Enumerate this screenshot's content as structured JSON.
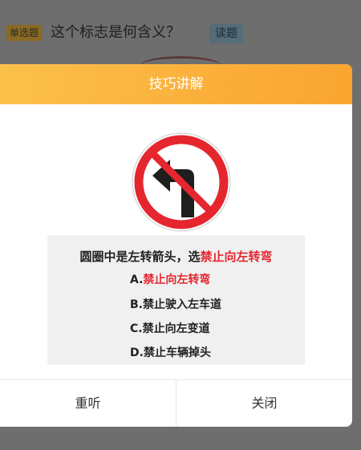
{
  "question": {
    "type_badge": "单选题",
    "text": "这个标志是何含义？",
    "read_button": "读题"
  },
  "modal": {
    "title": "技巧讲解",
    "hint_prefix": "圆圈中是左转箭头，选",
    "hint_answer": "禁止向左转弯",
    "options": [
      {
        "letter": "A.",
        "text": "禁止向左转弯",
        "correct": true
      },
      {
        "letter": "B.",
        "text": "禁止驶入左车道",
        "correct": false
      },
      {
        "letter": "C.",
        "text": "禁止向左变道",
        "correct": false
      },
      {
        "letter": "D.",
        "text": "禁止车辆掉头",
        "correct": false
      }
    ],
    "footer": {
      "replay": "重听",
      "close": "关闭"
    }
  },
  "colors": {
    "header_start": "#fbc04a",
    "header_end": "#f9a530",
    "answer_red": "#e5262f",
    "overlay": "#6e6e6e"
  },
  "sign": {
    "icon": "no-left-turn-sign-icon"
  }
}
